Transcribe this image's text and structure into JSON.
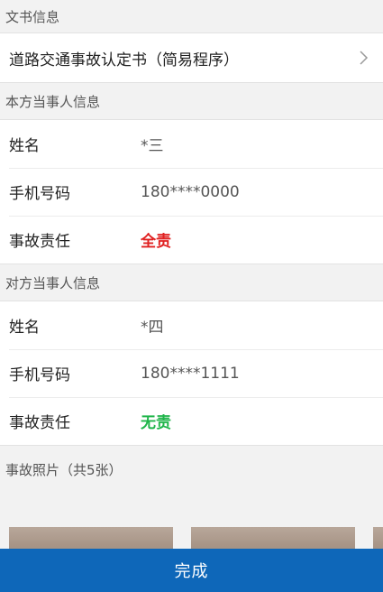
{
  "document_section": {
    "header": "文书信息",
    "document_title": "道路交通事故认定书（简易程序）"
  },
  "own_party": {
    "header": "本方当事人信息",
    "rows": [
      {
        "label": "姓名",
        "value": "*三"
      },
      {
        "label": "手机号码",
        "value": "180****0000"
      },
      {
        "label": "事故责任",
        "value": "全责"
      }
    ]
  },
  "other_party": {
    "header": "对方当事人信息",
    "rows": [
      {
        "label": "姓名",
        "value": "*四"
      },
      {
        "label": "手机号码",
        "value": "180****1111"
      },
      {
        "label": "事故责任",
        "value": "无责"
      }
    ]
  },
  "photos": {
    "header": "事故照片（共5张）",
    "count": 5
  },
  "footer": {
    "done_label": "完成"
  },
  "colors": {
    "primary": "#0e67b9",
    "full_responsibility": "#e02020",
    "no_responsibility": "#1fb54a"
  }
}
